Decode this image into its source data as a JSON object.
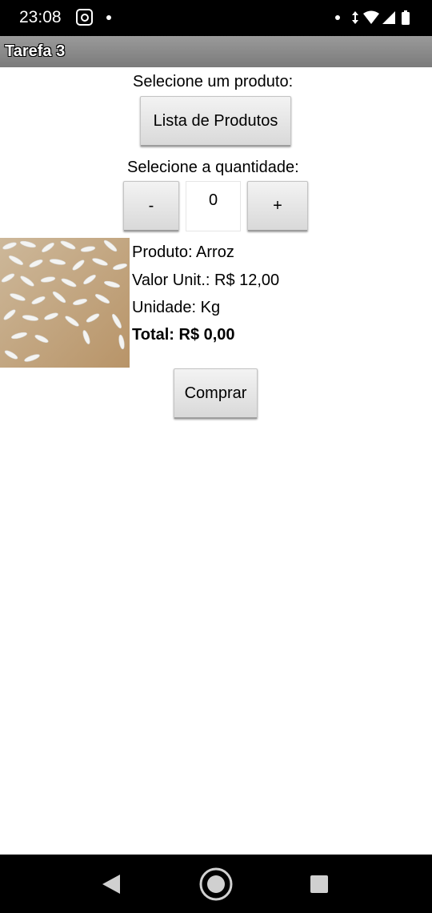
{
  "status_bar": {
    "time": "23:08",
    "icons": [
      "instagram-icon",
      "notification-dot-icon",
      "data-arrows-icon",
      "wifi-icon",
      "signal-icon",
      "battery-icon"
    ]
  },
  "app": {
    "title": "Tarefa 3"
  },
  "product_section": {
    "prompt": "Selecione um produto:",
    "list_button_label": "Lista de Produtos"
  },
  "quantity_section": {
    "prompt": "Selecione a quantidade:",
    "decrement_label": "-",
    "increment_label": "+",
    "value": "0"
  },
  "product": {
    "name_line": "Produto: Arroz",
    "unit_price_line": "Valor Unit.: R$ 12,00",
    "unit_line": "Unidade: Kg",
    "total_line": "Total: R$ 0,00",
    "image_icon": "rice-photo"
  },
  "actions": {
    "buy_label": "Comprar"
  },
  "nav_bar": {
    "icons": [
      "back-icon",
      "home-icon",
      "recents-icon"
    ]
  },
  "colors": {
    "status_bar": "#000000",
    "title_bar": "#8a8a8a",
    "button_face": "#e6e6e6",
    "nav_bar": "#000000"
  }
}
